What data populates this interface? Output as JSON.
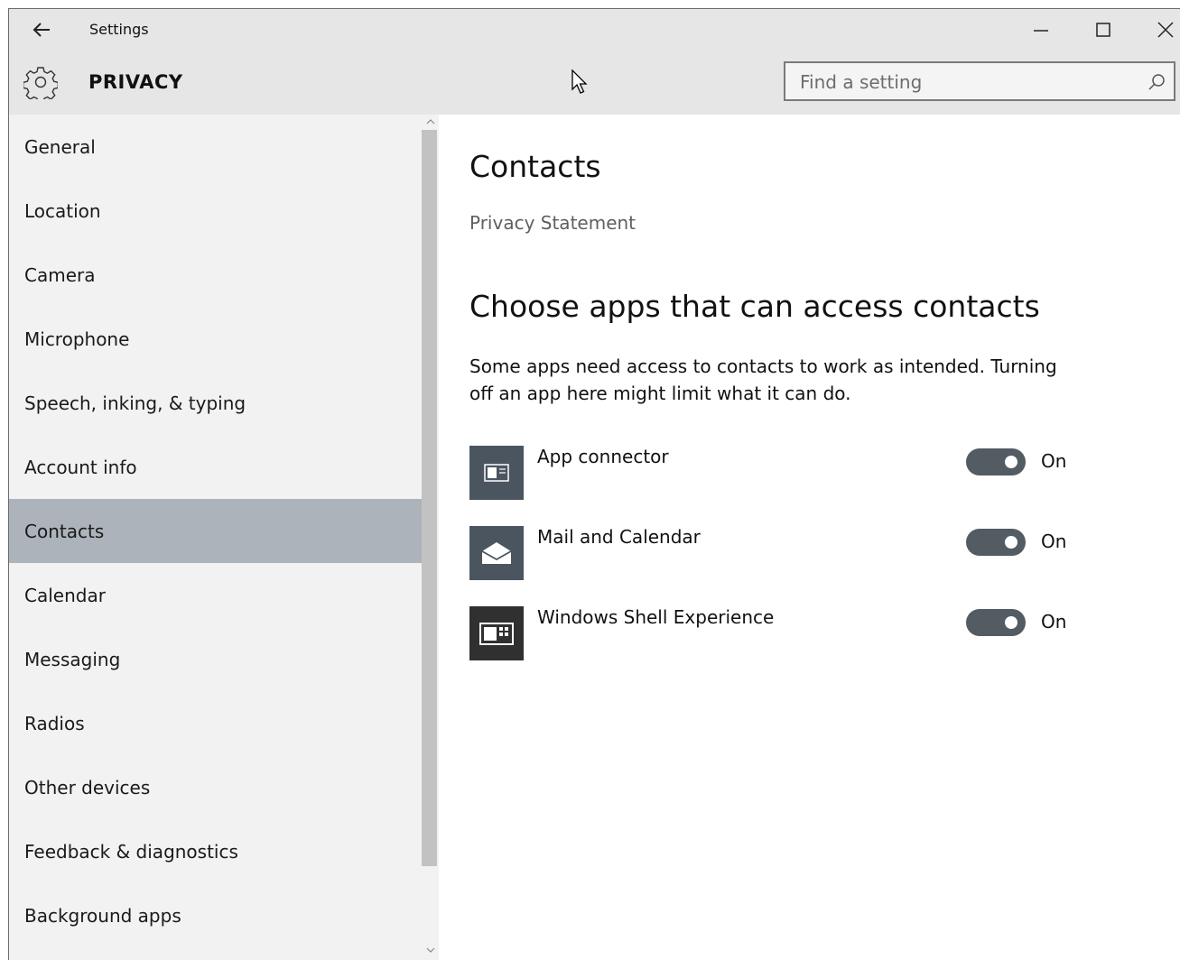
{
  "window": {
    "title": "Settings"
  },
  "header": {
    "title": "PRIVACY",
    "search_placeholder": "Find a setting"
  },
  "sidebar": {
    "items": [
      {
        "label": "General",
        "selected": false
      },
      {
        "label": "Location",
        "selected": false
      },
      {
        "label": "Camera",
        "selected": false
      },
      {
        "label": "Microphone",
        "selected": false
      },
      {
        "label": "Speech, inking, & typing",
        "selected": false
      },
      {
        "label": "Account info",
        "selected": false
      },
      {
        "label": "Contacts",
        "selected": true
      },
      {
        "label": "Calendar",
        "selected": false
      },
      {
        "label": "Messaging",
        "selected": false
      },
      {
        "label": "Radios",
        "selected": false
      },
      {
        "label": "Other devices",
        "selected": false
      },
      {
        "label": "Feedback & diagnostics",
        "selected": false
      },
      {
        "label": "Background apps",
        "selected": false
      }
    ]
  },
  "main": {
    "title": "Contacts",
    "privacy_link": "Privacy Statement",
    "section_title": "Choose apps that can access contacts",
    "description": "Some apps need access to contacts to work as intended. Turning off an app here might limit what it can do.",
    "apps": [
      {
        "name": "App connector",
        "icon": "app-connector-icon",
        "toggle_state": "On"
      },
      {
        "name": "Mail and Calendar",
        "icon": "mail-icon",
        "toggle_state": "On"
      },
      {
        "name": "Windows Shell Experience",
        "icon": "shell-experience-icon",
        "toggle_state": "On"
      }
    ]
  },
  "colors": {
    "chrome": "#e6e6e6",
    "sidebar": "#f2f2f2",
    "selected": "#adb3ba",
    "toggle_on": "#535b63",
    "app_tile": "#4a5560"
  }
}
